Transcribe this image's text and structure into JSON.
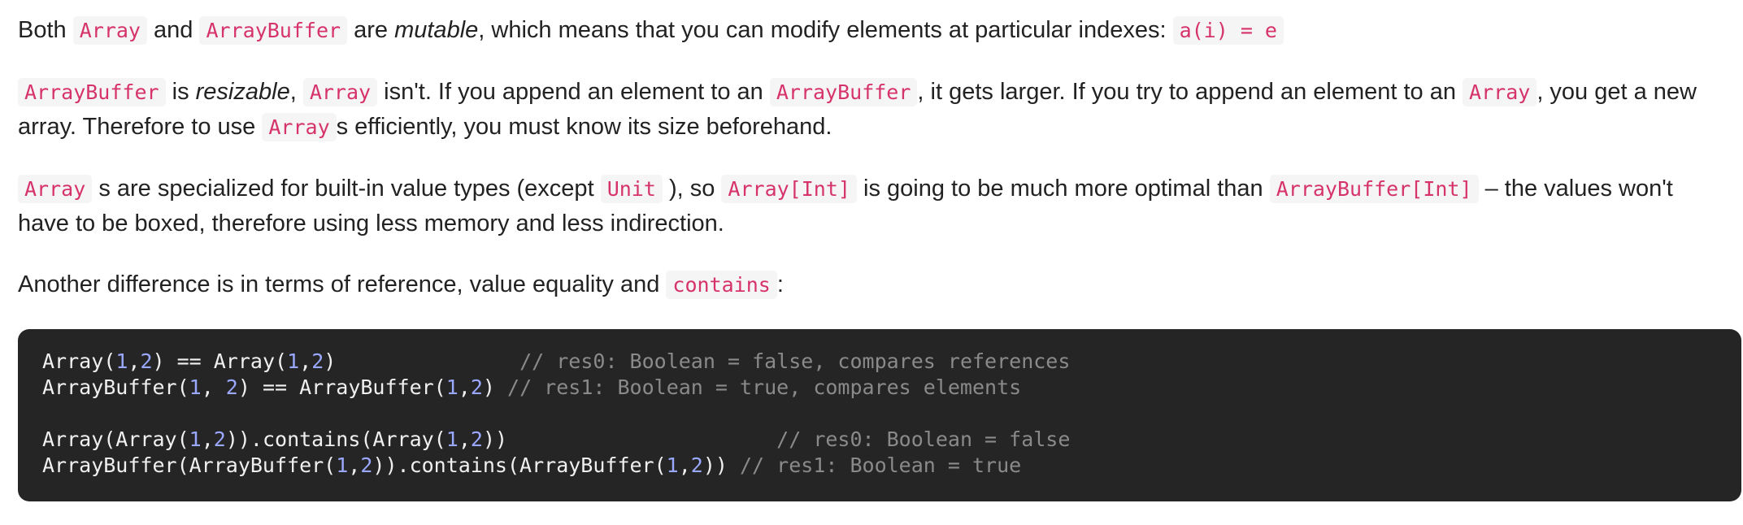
{
  "paragraphs": [
    {
      "segments": [
        {
          "t": "text",
          "v": "Both "
        },
        {
          "t": "code",
          "v": "Array"
        },
        {
          "t": "text",
          "v": " and "
        },
        {
          "t": "code",
          "v": "ArrayBuffer"
        },
        {
          "t": "text",
          "v": " are "
        },
        {
          "t": "em",
          "v": "mutable"
        },
        {
          "t": "text",
          "v": ", which means that you can modify elements at particular indexes: "
        },
        {
          "t": "code",
          "v": "a(i) = e"
        }
      ]
    },
    {
      "segments": [
        {
          "t": "code",
          "v": "ArrayBuffer"
        },
        {
          "t": "text",
          "v": " is "
        },
        {
          "t": "em",
          "v": "resizable"
        },
        {
          "t": "text",
          "v": ", "
        },
        {
          "t": "code",
          "v": "Array"
        },
        {
          "t": "text",
          "v": " isn't. If you append an element to an "
        },
        {
          "t": "code",
          "v": "ArrayBuffer"
        },
        {
          "t": "text",
          "v": ", it gets larger. If you try to append an element to an "
        },
        {
          "t": "code",
          "v": "Array"
        },
        {
          "t": "text",
          "v": ", you get a new array. Therefore to use "
        },
        {
          "t": "code",
          "v": "Array"
        },
        {
          "t": "text",
          "v": "s efficiently, you must know its size beforehand."
        }
      ]
    },
    {
      "segments": [
        {
          "t": "code",
          "v": "Array"
        },
        {
          "t": "text",
          "v": " s are specialized for built-in value types (except "
        },
        {
          "t": "code",
          "v": "Unit"
        },
        {
          "t": "text",
          "v": " ), so "
        },
        {
          "t": "code",
          "v": "Array[Int]"
        },
        {
          "t": "text",
          "v": " is going to be much more optimal than "
        },
        {
          "t": "code",
          "v": "ArrayBuffer[Int]"
        },
        {
          "t": "text",
          "v": " – the values won't have to be boxed, therefore using less memory and less indirection."
        }
      ]
    },
    {
      "segments": [
        {
          "t": "text",
          "v": "Another difference is in terms of reference, value equality and "
        },
        {
          "t": "code",
          "v": "contains"
        },
        {
          "t": "text",
          "v": ":"
        }
      ]
    }
  ],
  "code_block": {
    "lines": [
      [
        {
          "t": "p",
          "v": "Array("
        },
        {
          "t": "n",
          "v": "1"
        },
        {
          "t": "p",
          "v": ","
        },
        {
          "t": "n",
          "v": "2"
        },
        {
          "t": "p",
          "v": ") == Array("
        },
        {
          "t": "n",
          "v": "1"
        },
        {
          "t": "p",
          "v": ","
        },
        {
          "t": "n",
          "v": "2"
        },
        {
          "t": "p",
          "v": ")               "
        },
        {
          "t": "c",
          "v": "// res0: Boolean = false, compares references"
        }
      ],
      [
        {
          "t": "p",
          "v": "ArrayBuffer("
        },
        {
          "t": "n",
          "v": "1"
        },
        {
          "t": "p",
          "v": ", "
        },
        {
          "t": "n",
          "v": "2"
        },
        {
          "t": "p",
          "v": ") == ArrayBuffer("
        },
        {
          "t": "n",
          "v": "1"
        },
        {
          "t": "p",
          "v": ","
        },
        {
          "t": "n",
          "v": "2"
        },
        {
          "t": "p",
          "v": ") "
        },
        {
          "t": "c",
          "v": "// res1: Boolean = true, compares elements"
        }
      ],
      [],
      [
        {
          "t": "p",
          "v": "Array(Array("
        },
        {
          "t": "n",
          "v": "1"
        },
        {
          "t": "p",
          "v": ","
        },
        {
          "t": "n",
          "v": "2"
        },
        {
          "t": "p",
          "v": ")).contains(Array("
        },
        {
          "t": "n",
          "v": "1"
        },
        {
          "t": "p",
          "v": ","
        },
        {
          "t": "n",
          "v": "2"
        },
        {
          "t": "p",
          "v": "))                      "
        },
        {
          "t": "c",
          "v": "// res0: Boolean = false"
        }
      ],
      [
        {
          "t": "p",
          "v": "ArrayBuffer(ArrayBuffer("
        },
        {
          "t": "n",
          "v": "1"
        },
        {
          "t": "p",
          "v": ","
        },
        {
          "t": "n",
          "v": "2"
        },
        {
          "t": "p",
          "v": ")).contains(ArrayBuffer("
        },
        {
          "t": "n",
          "v": "1"
        },
        {
          "t": "p",
          "v": ","
        },
        {
          "t": "n",
          "v": "2"
        },
        {
          "t": "p",
          "v": ")) "
        },
        {
          "t": "c",
          "v": "// res1: Boolean = true"
        }
      ]
    ]
  },
  "colors": {
    "inline_code_text": "#d6336c",
    "inline_code_bg": "#f5f5f5",
    "code_block_bg": "#252525",
    "code_number": "#9aa8ff",
    "code_comment": "#8a8a8a"
  }
}
